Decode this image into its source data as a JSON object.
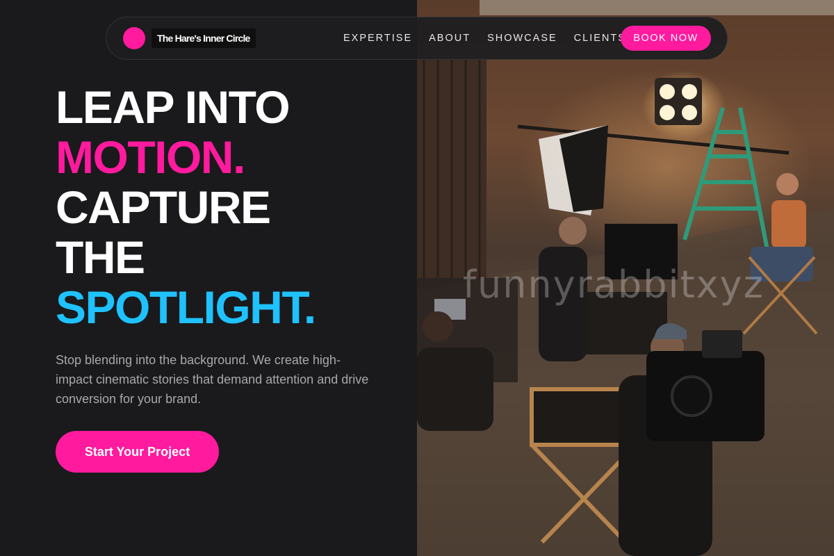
{
  "brand": {
    "name": "The Hare's Inner Circle",
    "accent_color": "#ff1a9e"
  },
  "nav": {
    "links": [
      "EXPERTISE",
      "ABOUT",
      "SHOWCASE",
      "CLIENTS"
    ],
    "cta_label": "BOOK NOW"
  },
  "hero": {
    "headline_lines": [
      {
        "text": "LEAP INTO",
        "color": "#ffffff"
      },
      {
        "text": "MOTION.",
        "color": "#ff1a9e"
      },
      {
        "text": "CAPTURE",
        "color": "#ffffff"
      },
      {
        "text": "THE",
        "color": "#ffffff"
      },
      {
        "text": "SPOTLIGHT.",
        "color": "#1fc2ff"
      }
    ],
    "subtext": "Stop blending into the background. We create high-impact cinematic stories that demand attention and drive conversion for your brand.",
    "cta_label": "Start Your Project"
  },
  "photo": {
    "watermark": "funnyrabbitxyz"
  }
}
